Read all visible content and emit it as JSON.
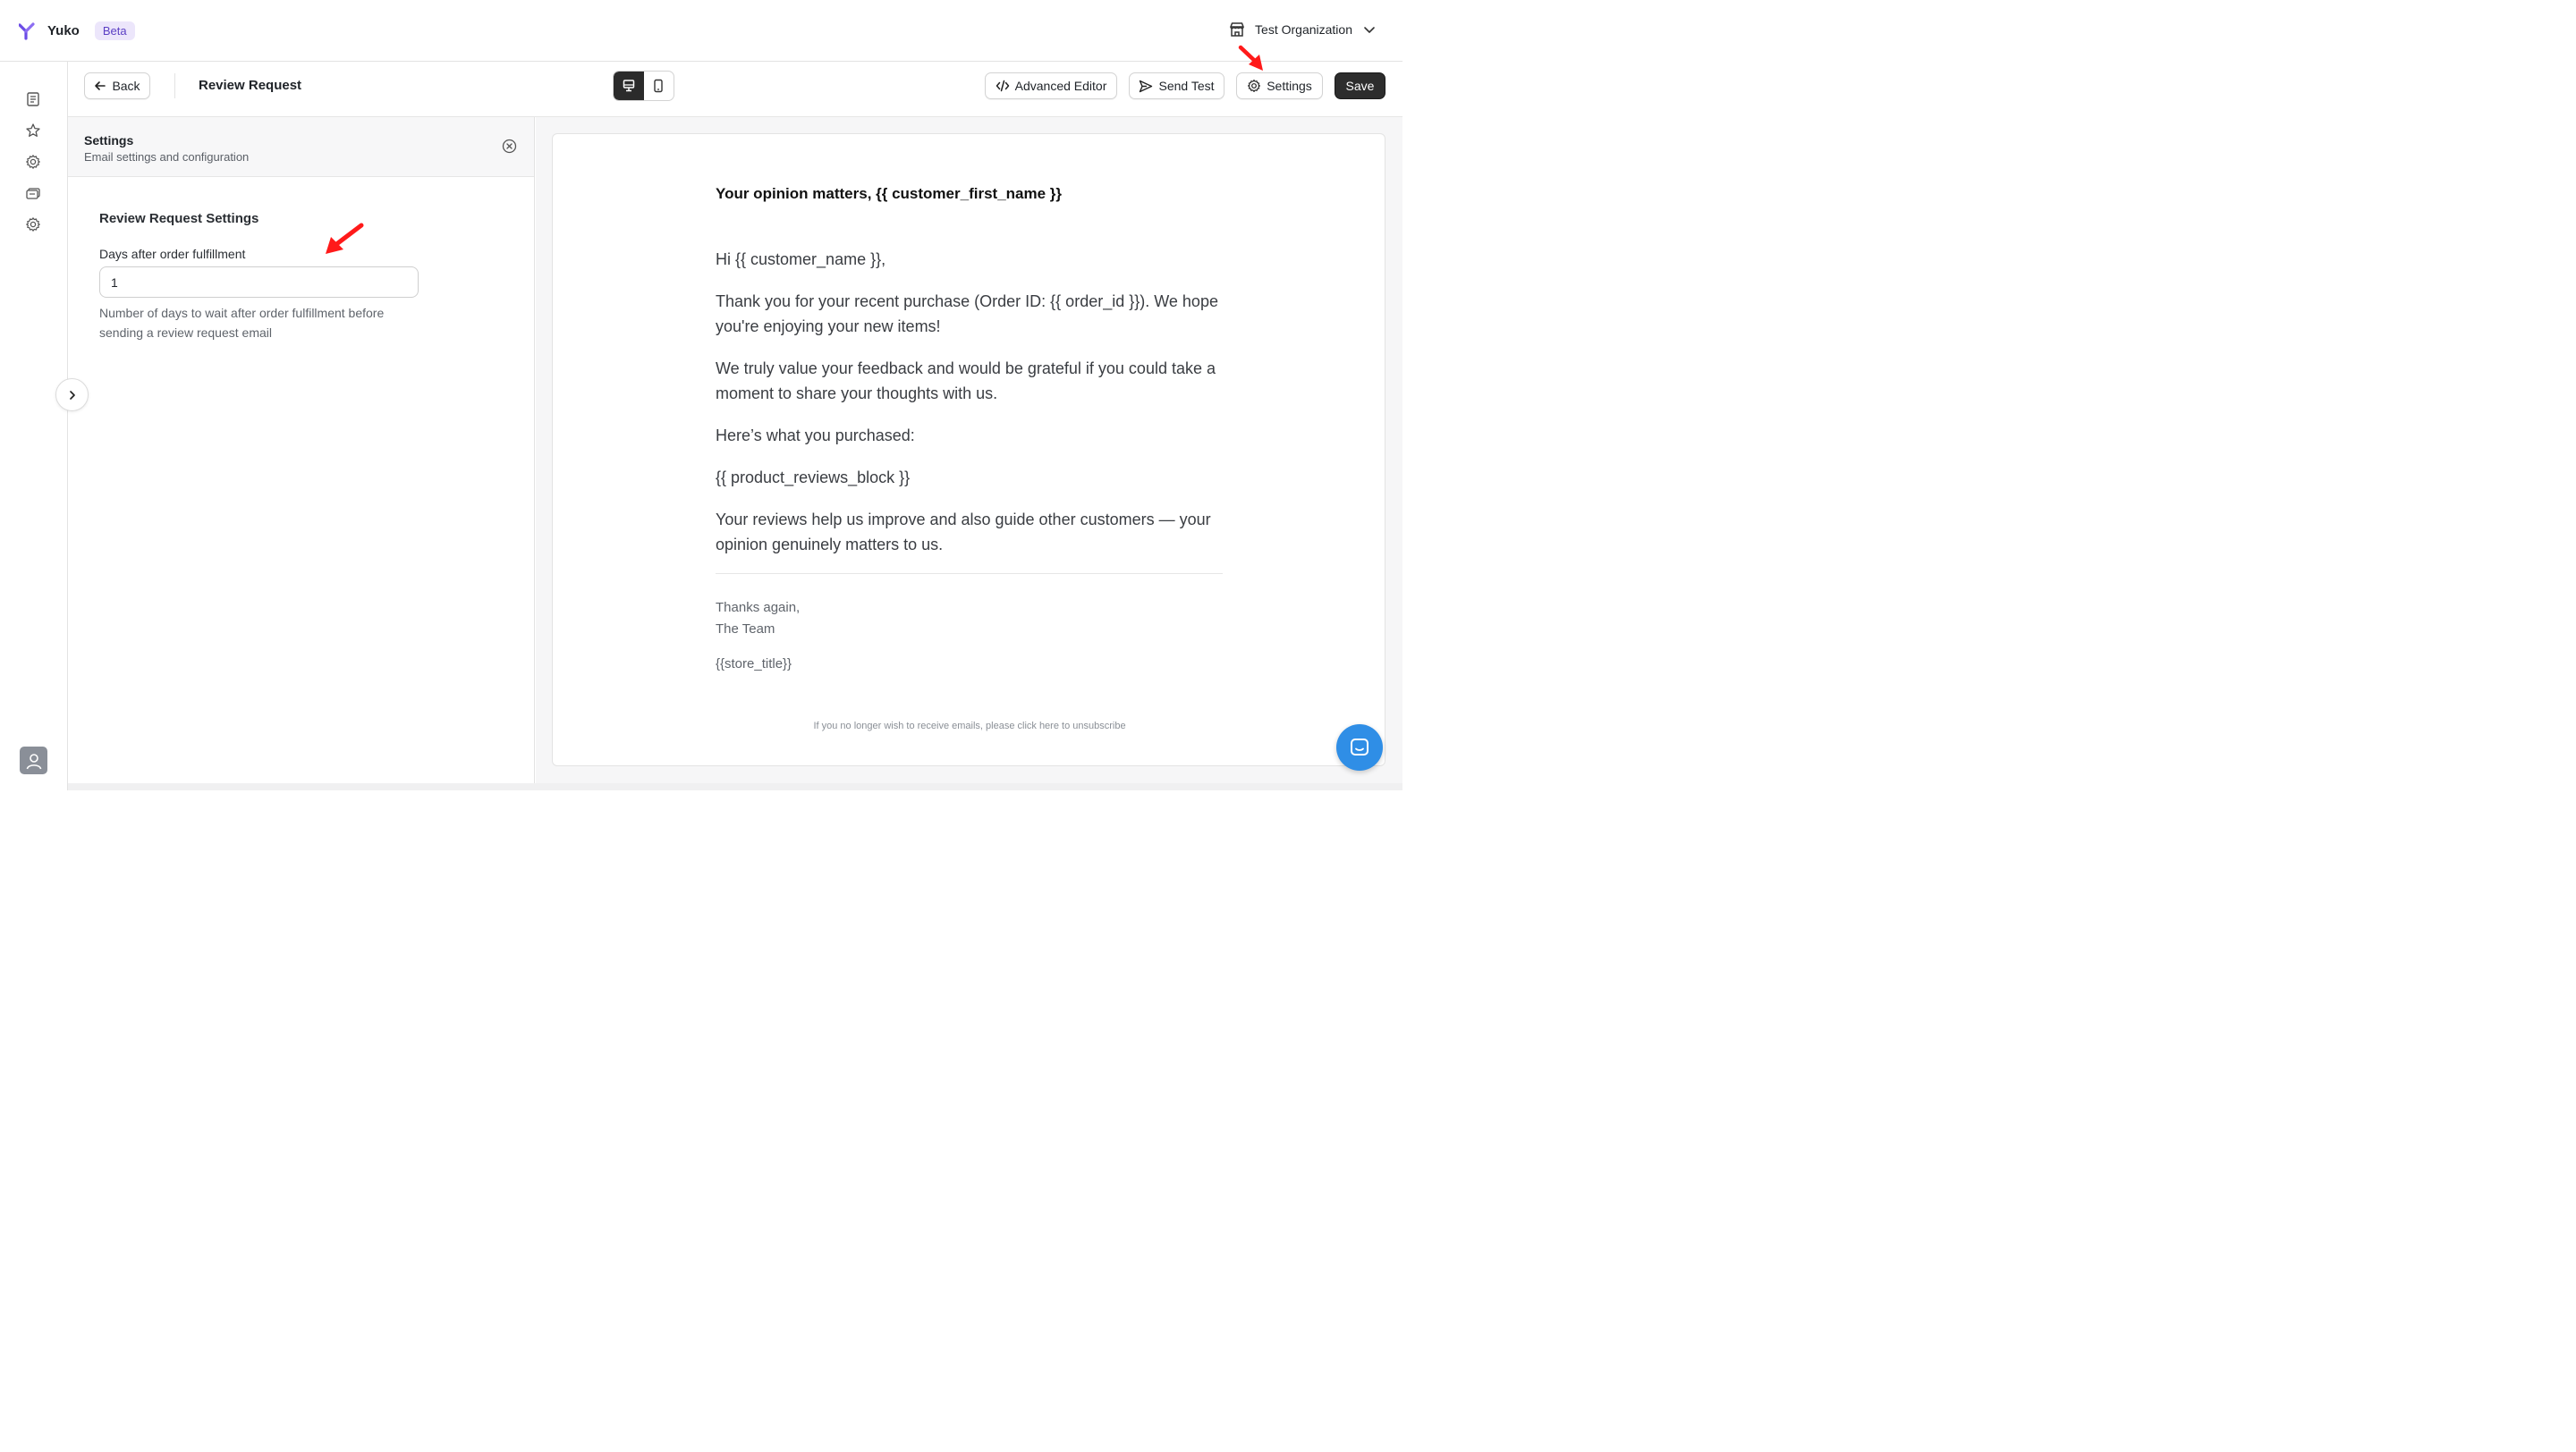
{
  "app": {
    "name": "Yuko",
    "badge": "Beta",
    "organization": "Test Organization"
  },
  "editor": {
    "back_label": "Back",
    "title": "Review Request",
    "view_modes": [
      "desktop-icon",
      "mobile-icon"
    ],
    "active_view": "desktop",
    "advanced_editor_label": "Advanced Editor",
    "send_test_label": "Send Test",
    "settings_label": "Settings",
    "save_label": "Save"
  },
  "settings_panel": {
    "title": "Settings",
    "subtitle": "Email settings and configuration",
    "section_title": "Review Request Settings",
    "field_label": "Days after order fulfillment",
    "field_value": "1",
    "field_help": "Number of days to wait after order fulfillment before sending a review request email"
  },
  "email": {
    "heading": "Your opinion matters, {{ customer_first_name }}",
    "greeting": "Hi {{ customer_name }},",
    "p1": "Thank you for your recent purchase (Order ID: {{ order_id }}). We hope you're enjoying your new items!",
    "p2": "We truly value your feedback and would be grateful if you could take a moment to share your thoughts with us.",
    "p3": "Here’s what you purchased:",
    "p4": "{{ product_reviews_block }}",
    "p5": "Your reviews help us improve and also guide other customers — your opinion genuinely matters to us.",
    "signoff_line1": "Thanks again,",
    "signoff_line2": "The Team",
    "store_title": "{{store_title}}",
    "unsubscribe": "If you no longer wish to receive emails, please click here to unsubscribe"
  },
  "nav_icons": [
    "book-icon",
    "star-icon",
    "gear-icon",
    "cards-icon",
    "gear-icon"
  ],
  "colors": {
    "brand_purple": "#6b4ce6",
    "badge_bg": "#ece6fb",
    "save_bg": "#2d2d2d",
    "chat_blue": "#2f8ee6",
    "annotation_red": "#ff1a1a"
  }
}
